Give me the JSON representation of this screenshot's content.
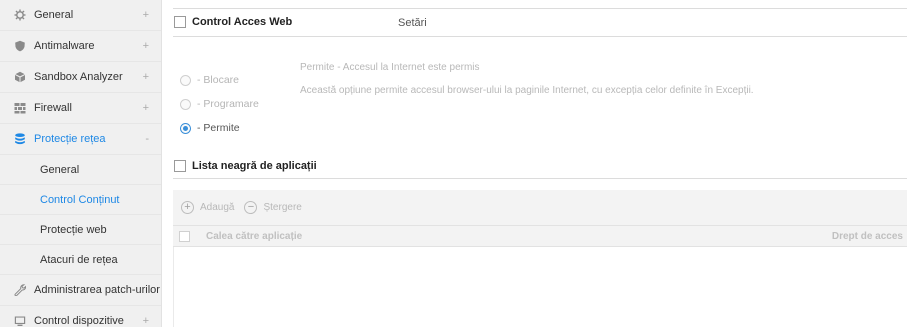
{
  "sidebar": {
    "items": [
      {
        "label": "General",
        "icon": "gear-icon",
        "toggle": "+"
      },
      {
        "label": "Antimalware",
        "icon": "shield-icon",
        "toggle": "+"
      },
      {
        "label": "Sandbox Analyzer",
        "icon": "cube-icon",
        "toggle": "+"
      },
      {
        "label": "Firewall",
        "icon": "firewall-icon",
        "toggle": "+"
      },
      {
        "label": "Protecție rețea",
        "icon": "network-icon",
        "toggle": "-"
      },
      {
        "label": "Administrarea patch-urilor",
        "icon": "wrench-icon",
        "toggle": ""
      },
      {
        "label": "Control dispozitive",
        "icon": "device-icon",
        "toggle": "+"
      }
    ],
    "subitems": [
      {
        "label": "General"
      },
      {
        "label": "Control Conținut"
      },
      {
        "label": "Protecție web"
      },
      {
        "label": "Atacuri de rețea"
      }
    ]
  },
  "main": {
    "web_control": {
      "title": "Control Acces Web",
      "settings_label": "Setări"
    },
    "radios": [
      {
        "label": "- Blocare",
        "checked": false
      },
      {
        "label": "- Programare",
        "checked": false
      },
      {
        "label": "- Permite",
        "checked": true
      }
    ],
    "description": {
      "title": "Permite - Accesul la Internet este permis",
      "text": "Această opțiune permite accesul browser-ului la paginile Internet, cu excepția celor definite în Excepții."
    },
    "blacklist": {
      "title": "Lista neagră de aplicații"
    },
    "toolbar": {
      "add_label": "Adaugă",
      "delete_label": "Ștergere"
    },
    "table": {
      "col_path": "Calea către aplicație",
      "col_access": "Drept de acces"
    }
  },
  "colors": {
    "accent": "#1e88e5",
    "sidebar_bg": "#f0f0f0"
  }
}
